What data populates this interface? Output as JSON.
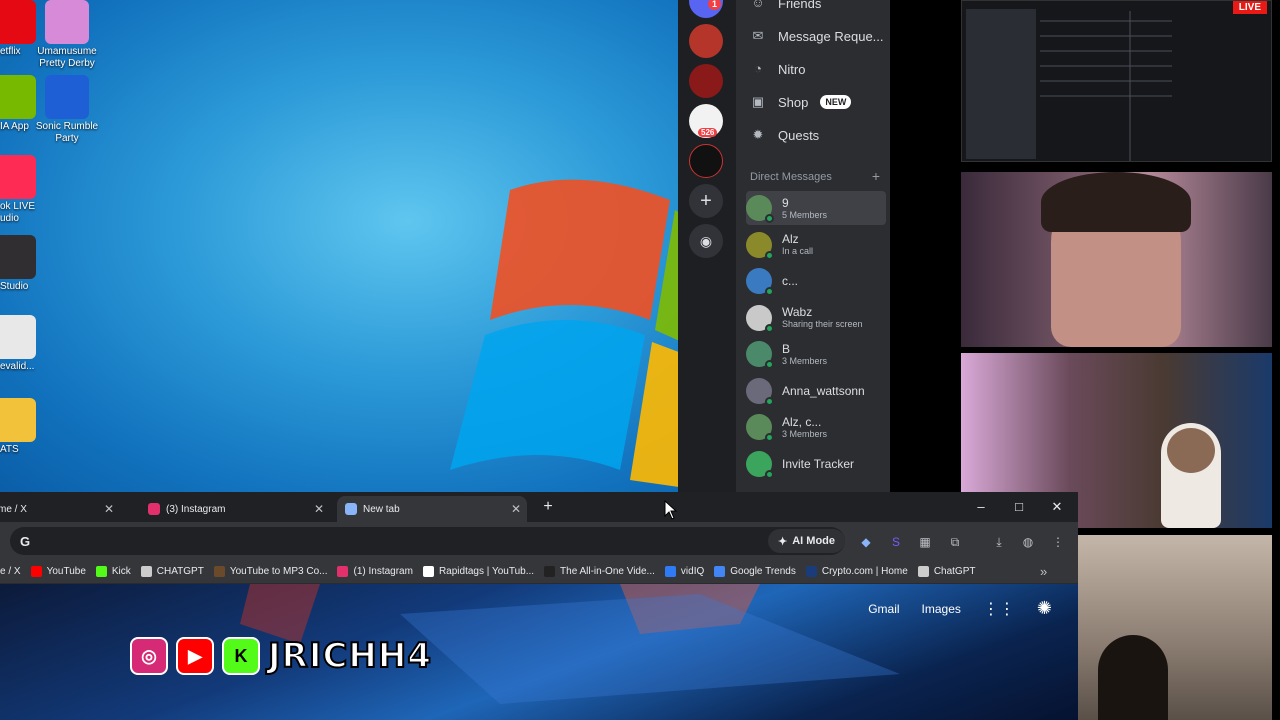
{
  "desktop": {
    "icons": [
      {
        "label": "etflix",
        "color": "#e50914"
      },
      {
        "label": "Umamusume Pretty Derby",
        "color": "#d78ad8"
      },
      {
        "label": "IA App",
        "color": "#76b900"
      },
      {
        "label": "Sonic Rumble Party",
        "color": "#1f5fd6"
      },
      {
        "label": "ok LIVE udio",
        "color": "#fe2c55"
      },
      {
        "label": "Studio",
        "color": "#302e31"
      },
      {
        "label": "evalid...",
        "color": "#e8e8e8"
      },
      {
        "label": "ATS",
        "color": "#f2c23a"
      }
    ]
  },
  "discord": {
    "notif_badge": "1",
    "server_badge": "526",
    "nav": [
      {
        "label": "Friends",
        "icon": "friends-icon"
      },
      {
        "label": "Message Reque...",
        "icon": "mail-icon"
      },
      {
        "label": "Nitro",
        "icon": "nitro-icon"
      },
      {
        "label": "Shop",
        "icon": "shop-icon",
        "badge": "NEW"
      },
      {
        "label": "Quests",
        "icon": "quests-icon"
      }
    ],
    "dm_header": "Direct Messages",
    "dm_add": "+",
    "dms": [
      {
        "name": "9",
        "sub": "5 Members",
        "color": "#5a8a5a",
        "active": true
      },
      {
        "name": "Alz",
        "sub": "In a call",
        "color": "#8a8a2a"
      },
      {
        "name": "c...",
        "sub": "",
        "color": "#3a7ac0"
      },
      {
        "name": "Wabz",
        "sub": "Sharing their screen",
        "color": "#c9c9c9"
      },
      {
        "name": "B",
        "sub": "3 Members",
        "color": "#4a8a6a"
      },
      {
        "name": "Anna_wattsonn",
        "sub": "",
        "color": "#6a6a7a"
      },
      {
        "name": "Alz, c...",
        "sub": "3 Members",
        "color": "#5a8a5a"
      },
      {
        "name": "Invite Tracker",
        "sub": "",
        "color": "#3ba55d"
      }
    ]
  },
  "stream": {
    "live_label": "LIVE"
  },
  "chrome": {
    "tabs": [
      {
        "title": "me / X",
        "color": "#000000"
      },
      {
        "title": "(3) Instagram",
        "color": "#e1306c"
      },
      {
        "title": "New tab",
        "color": "#8ab4f8",
        "active": true
      }
    ],
    "new_tab_button": "+",
    "address_placeholder": "",
    "ai_mode_label": "AI Mode",
    "bookmarks": [
      {
        "label": "e / X",
        "color": "#000000"
      },
      {
        "label": "YouTube",
        "color": "#ff0000"
      },
      {
        "label": "Kick",
        "color": "#53fc18"
      },
      {
        "label": "CHATGPT",
        "color": "#cccccc"
      },
      {
        "label": "YouTube to MP3 Co...",
        "color": "#6a4a2a"
      },
      {
        "label": "(1) Instagram",
        "color": "#e1306c"
      },
      {
        "label": "Rapidtags | YouTub...",
        "color": "#ffffff"
      },
      {
        "label": "The All-in-One Vide...",
        "color": "#222222"
      },
      {
        "label": "vidIQ",
        "color": "#2f7bf5"
      },
      {
        "label": "Google Trends",
        "color": "#4285f4"
      },
      {
        "label": "Crypto.com | Home",
        "color": "#1a3c7a"
      },
      {
        "label": "ChatGPT",
        "color": "#cccccc"
      }
    ],
    "more_bookmarks": "»",
    "ntp_links": {
      "gmail": "Gmail",
      "images": "Images"
    }
  },
  "overlay": {
    "handle": "JRICHH4",
    "socials": [
      {
        "name": "instagram",
        "color": "#d62976",
        "glyph": "◎"
      },
      {
        "name": "youtube",
        "color": "#ff0000",
        "glyph": "▶"
      },
      {
        "name": "kick",
        "color": "#53fc18",
        "glyph": "K"
      }
    ]
  }
}
